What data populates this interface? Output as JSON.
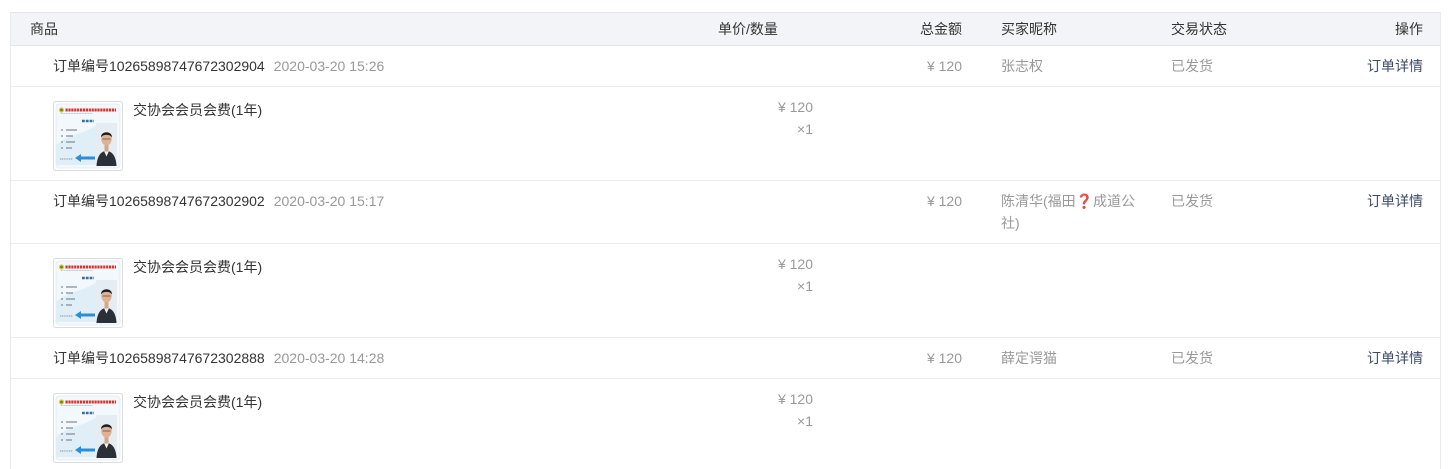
{
  "header": {
    "product": "商品",
    "price_qty": "单价/数量",
    "total": "总金额",
    "buyer": "买家昵称",
    "status": "交易状态",
    "action": "操作"
  },
  "orders": [
    {
      "order_no": "订单编号10265898747672302904",
      "time": "2020-03-20 15:26",
      "total": "¥ 120",
      "buyer": "张志权",
      "status": "已发货",
      "action": "订单详情",
      "items": [
        {
          "name": "交协会会员会费(1年)",
          "price": "¥ 120",
          "qty": "×1"
        }
      ]
    },
    {
      "order_no": "订单编号10265898747672302902",
      "time": "2020-03-20 15:17",
      "total": "¥ 120",
      "buyer": "陈清华(福田❓成道公社)",
      "status": "已发货",
      "action": "订单详情",
      "items": [
        {
          "name": "交协会会员会费(1年)",
          "price": "¥ 120",
          "qty": "×1"
        }
      ]
    },
    {
      "order_no": "订单编号10265898747672302888",
      "time": "2020-03-20 14:28",
      "total": "¥ 120",
      "buyer": "薛定谔猫",
      "status": "已发货",
      "action": "订单详情",
      "items": [
        {
          "name": "交协会会员会费(1年)",
          "price": "¥ 120",
          "qty": "×1"
        }
      ]
    }
  ],
  "colors": {
    "header_bg": "#f3f4f7",
    "text": "#333333",
    "muted": "#999999",
    "link": "#3c4a6b",
    "border": "#ebedf0",
    "question_mark": "#d9302f"
  }
}
